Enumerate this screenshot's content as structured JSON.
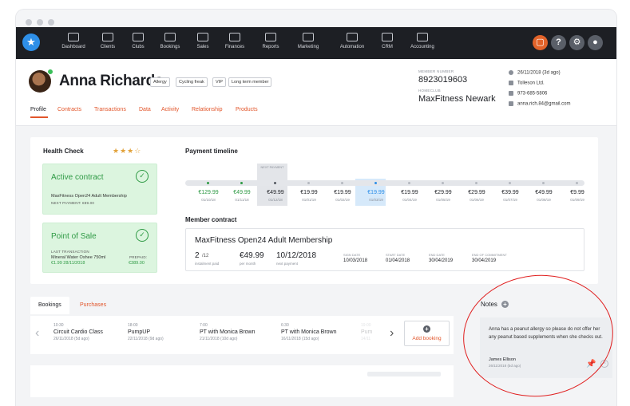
{
  "nav": {
    "items": [
      {
        "label": "Dashboard",
        "icon": "dashboard-icon"
      },
      {
        "label": "Clients",
        "icon": "clients-icon"
      },
      {
        "label": "Clubs",
        "icon": "clubs-icon"
      },
      {
        "label": "Bookings",
        "icon": "bookings-icon"
      },
      {
        "label": "Sales",
        "icon": "sales-icon"
      },
      {
        "label": "Finances",
        "icon": "finances-icon"
      },
      {
        "label": "Reports",
        "icon": "reports-icon"
      },
      {
        "label": "Marketing",
        "icon": "marketing-icon"
      },
      {
        "label": "Automation",
        "icon": "automation-icon"
      },
      {
        "label": "CRM",
        "icon": "crm-icon"
      },
      {
        "label": "Accounting",
        "icon": "accounting-icon"
      }
    ],
    "help_label": "?"
  },
  "profile": {
    "name": "Anna Richards",
    "tags": [
      "Allergy",
      "Cycling freak",
      "VIP",
      "Long term member"
    ],
    "tabs": [
      "Profile",
      "Contracts",
      "Transactions",
      "Data",
      "Activity",
      "Relationship",
      "Products"
    ],
    "member_number_label": "MEMBER NUMBER",
    "member_number": "8923019603",
    "homeclub_label": "HOMECLUB",
    "homeclub": "MaxFitness Newark",
    "contacts": [
      "26/11/2018 (3d ago)",
      "Tolleson Ltd.",
      "973-685-5806",
      "anna.rich.84@gmail.com"
    ]
  },
  "health": {
    "title": "Health Check",
    "stars": "★★★☆",
    "active_contract": {
      "title": "Active contract",
      "description": "MaxFitness Open24 Adult Membership",
      "next_payment": "NEXT PAYMENT: €89.00"
    },
    "pos": {
      "title": "Point of Sale",
      "last_label": "LAST TRANSACTION",
      "last_item": "Mineral Water Oshee 750ml",
      "last_amount": "€1.99  28/11/2018",
      "prepaid_label": "PREPAID:",
      "prepaid_amount": "€389.00"
    }
  },
  "timeline": {
    "title": "Payment timeline",
    "next_label": "NEXT PAYMENT",
    "payments": [
      {
        "amount": "€129.99",
        "date": "01/10/18",
        "status": "paid"
      },
      {
        "amount": "€49.99",
        "date": "01/11/18",
        "status": "paid"
      },
      {
        "amount": "€49.99",
        "date": "01/12/18",
        "status": "next"
      },
      {
        "amount": "€19.99",
        "date": "01/01/19",
        "status": "future"
      },
      {
        "amount": "€19.99",
        "date": "01/02/19",
        "status": "future"
      },
      {
        "amount": "€19.99",
        "date": "01/03/19",
        "status": "selected"
      },
      {
        "amount": "€19.99",
        "date": "01/04/19",
        "status": "future"
      },
      {
        "amount": "€29.99",
        "date": "01/05/19",
        "status": "future"
      },
      {
        "amount": "€29.99",
        "date": "01/06/19",
        "status": "future"
      },
      {
        "amount": "€39.99",
        "date": "01/07/19",
        "status": "future"
      },
      {
        "amount": "€49.99",
        "date": "01/08/19",
        "status": "future"
      },
      {
        "amount": "€9.99",
        "date": "01/09/19",
        "status": "future"
      }
    ],
    "colors": {
      "paid": "#2f9a45",
      "selected": "#2e8fe8",
      "next": "#555a62",
      "future": "#b5b9c0"
    }
  },
  "contract": {
    "section_title": "Member contract",
    "name": "MaxFitness Open24 Adult Membership",
    "installment_value": "2",
    "installment_total": "/12",
    "installment_label": "instalment paid",
    "per_month_value": "€49.99",
    "per_month_label": "per month",
    "next_payment_value": "10/12/2018",
    "next_payment_label": "next payment",
    "sign_date_label": "SIGN DATE",
    "sign_date": "10/03/2018",
    "start_date_label": "START DATE",
    "start_date": "01/04/2018",
    "end_date_label": "END DATE",
    "end_date": "30/04/2019",
    "end_commit_label": "END OF COMMITMENT",
    "end_commit": "30/04/2019"
  },
  "bookings": {
    "tabs": [
      "Bookings",
      "Purchases"
    ],
    "items": [
      {
        "time": "10:30",
        "name": "Circuit Cardio Class",
        "date": "26/11/2018 (5d ago)"
      },
      {
        "time": "18:00",
        "name": "PumpUP",
        "date": "22/11/2018 (9d ago)"
      },
      {
        "time": "7:00",
        "name": "PT with Monica Brown",
        "date": "21/11/2018 (10d ago)"
      },
      {
        "time": "6:30",
        "name": "PT with Monica Brown",
        "date": "16/11/2018 (15d ago)"
      },
      {
        "time": "19:00",
        "name": "Pum",
        "date": "14/11"
      }
    ],
    "add_label": "Add booking"
  },
  "notes": {
    "title": "Notes",
    "text": "Anna has a peanut allergy so please do not offer her any peanut based supplements when she checks out.",
    "author": "James Ellison",
    "date": "26/11/2018 (5d ago)"
  }
}
